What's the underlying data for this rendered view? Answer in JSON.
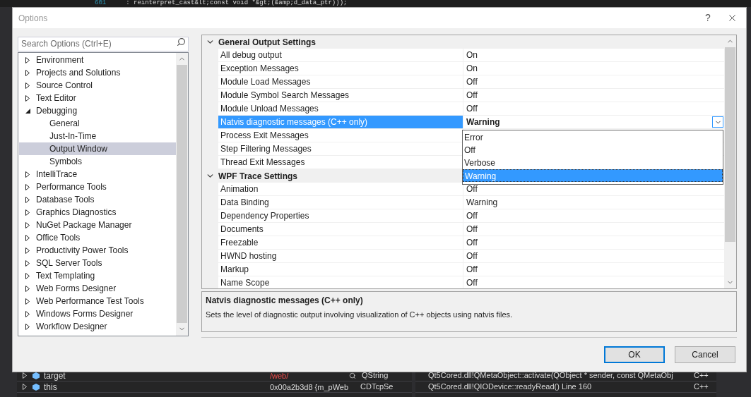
{
  "editor_line": {
    "line_number": "601",
    "code": ": reinterpret_cast&lt;const void *&gt;(&amp;d_data_ptr)));"
  },
  "dialog": {
    "title": "Options",
    "help": "?"
  },
  "search": {
    "placeholder": "Search Options (Ctrl+E)"
  },
  "tree": [
    {
      "label": "Environment",
      "expanded": false,
      "selected": false
    },
    {
      "label": "Projects and Solutions",
      "expanded": false,
      "selected": false
    },
    {
      "label": "Source Control",
      "expanded": false,
      "selected": false
    },
    {
      "label": "Text Editor",
      "expanded": false,
      "selected": false
    },
    {
      "label": "Debugging",
      "expanded": true,
      "selected": false,
      "children": [
        {
          "label": "General",
          "selected": false
        },
        {
          "label": "Just-In-Time",
          "selected": false
        },
        {
          "label": "Output Window",
          "selected": true
        },
        {
          "label": "Symbols",
          "selected": false
        }
      ]
    },
    {
      "label": "IntelliTrace",
      "expanded": false,
      "selected": false
    },
    {
      "label": "Performance Tools",
      "expanded": false,
      "selected": false
    },
    {
      "label": "Database Tools",
      "expanded": false,
      "selected": false
    },
    {
      "label": "Graphics Diagnostics",
      "expanded": false,
      "selected": false
    },
    {
      "label": "NuGet Package Manager",
      "expanded": false,
      "selected": false
    },
    {
      "label": "Office Tools",
      "expanded": false,
      "selected": false
    },
    {
      "label": "Productivity Power Tools",
      "expanded": false,
      "selected": false
    },
    {
      "label": "SQL Server Tools",
      "expanded": false,
      "selected": false
    },
    {
      "label": "Text Templating",
      "expanded": false,
      "selected": false
    },
    {
      "label": "Web Forms Designer",
      "expanded": false,
      "selected": false
    },
    {
      "label": "Web Performance Test Tools",
      "expanded": false,
      "selected": false
    },
    {
      "label": "Windows Forms Designer",
      "expanded": false,
      "selected": false
    },
    {
      "label": "Workflow Designer",
      "expanded": false,
      "selected": false
    }
  ],
  "property_grid": {
    "categories": [
      {
        "name": "General Output Settings",
        "expanded": true,
        "properties": [
          {
            "name": "All debug output",
            "value": "On",
            "selected": false
          },
          {
            "name": "Exception Messages",
            "value": "On",
            "selected": false
          },
          {
            "name": "Module Load Messages",
            "value": "Off",
            "selected": false
          },
          {
            "name": "Module Symbol Search Messages",
            "value": "Off",
            "selected": false
          },
          {
            "name": "Module Unload Messages",
            "value": "Off",
            "selected": false
          },
          {
            "name": "Natvis diagnostic messages (C++ only)",
            "value": "Warning",
            "selected": true,
            "dropdown": {
              "options": [
                {
                  "label": "Error",
                  "selected": false
                },
                {
                  "label": "Off",
                  "selected": false
                },
                {
                  "label": "Verbose",
                  "selected": false
                },
                {
                  "label": "Warning",
                  "selected": true
                }
              ]
            }
          },
          {
            "name": "Process Exit Messages",
            "selected": false
          },
          {
            "name": "Step Filtering Messages",
            "selected": false
          },
          {
            "name": "Thread Exit Messages",
            "selected": false
          }
        ]
      },
      {
        "name": "WPF Trace Settings",
        "expanded": true,
        "properties": [
          {
            "name": "Animation",
            "value": "Off",
            "selected": false
          },
          {
            "name": "Data Binding",
            "value": "Warning",
            "selected": false
          },
          {
            "name": "Dependency Properties",
            "value": "Off",
            "selected": false
          },
          {
            "name": "Documents",
            "value": "Off",
            "selected": false
          },
          {
            "name": "Freezable",
            "value": "Off",
            "selected": false
          },
          {
            "name": "HWND hosting",
            "value": "Off",
            "selected": false
          },
          {
            "name": "Markup",
            "value": "Off",
            "selected": false
          },
          {
            "name": "Name Scope",
            "value": "Off",
            "selected": false
          }
        ]
      }
    ]
  },
  "description": {
    "title": "Natvis diagnostic messages (C++ only)",
    "text": "Sets the level of diagnostic output involving visualization of C++ objects using natvis files."
  },
  "buttons": [
    {
      "label": "OK",
      "default": true
    },
    {
      "label": "Cancel",
      "default": false
    }
  ],
  "locals": [
    {
      "name": "target",
      "value": "/web/",
      "type": "QString",
      "changed": true
    },
    {
      "name": "this",
      "value": "0x00a2b3d8 {m_pWeb",
      "type": "CDTcpSe",
      "changed": false
    }
  ],
  "call_stack": [
    {
      "frame": "Qt5Cored.dll!QMetaObject::activate(QObject * sender, const QMetaObj",
      "language": "C++"
    },
    {
      "frame": "Qt5Cored.dll!QIODevice::readyRead() Line 160",
      "language": "C++"
    }
  ]
}
